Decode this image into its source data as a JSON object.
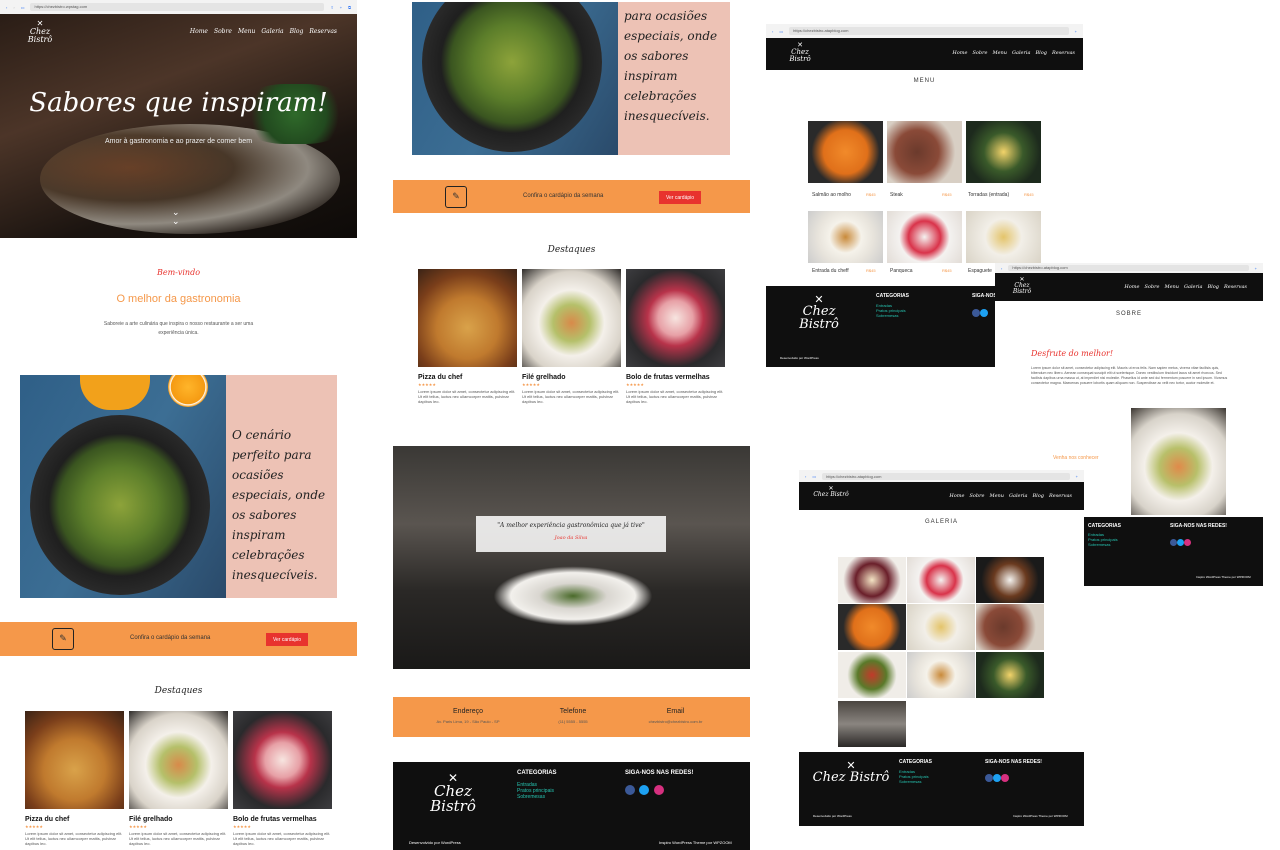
{
  "browser": {
    "url": "https://chezbistro.wpstag.com",
    "url_short": "https://chezbistro.atapblog.com"
  },
  "site": {
    "logo": "Chez Bistrô",
    "nav": [
      "Home",
      "Sobre",
      "Menu",
      "Galeria",
      "Blog",
      "Reservas"
    ]
  },
  "hero": {
    "title": "Sabores que inspiram!",
    "subtitle": "Amor à gastronomia e ao prazer de comer bem"
  },
  "welcome": {
    "kicker": "Bem-vindo",
    "title": "O melhor da gastronomia",
    "text": "Saboreie a arte culinária que inspira o nosso restaurante a ser uma experiência única."
  },
  "feature": {
    "quote": "O cenário perfeito para ocasiões especiais, onde os sabores inspiram celebrações inesquecíveis.",
    "quote_partial": "para ocasiões especiais, onde os sabores inspiram celebrações inesquecíveis."
  },
  "cta": {
    "text": "Confira o cardápio da semana",
    "button": "Ver cardápio"
  },
  "highlights": {
    "title": "Destaques",
    "items": [
      {
        "name": "Pizza du chef",
        "stars": "★★★★★",
        "text": "Lorem ipsum dolor sit amet, consectetur adipiscing elit. Ut elit tellus, luctus nec ullamcorper mattis, pulvinar dapibus leo."
      },
      {
        "name": "Filé grelhado",
        "stars": "★★★★★",
        "text": "Lorem ipsum dolor sit amet, consectetur adipiscing elit. Ut elit tellus, luctus nec ullamcorper mattis, pulvinar dapibus leo."
      },
      {
        "name": "Bolo de frutas vermelhas",
        "stars": "★★★★★",
        "text": "Lorem ipsum dolor sit amet, consectetur adipiscing elit. Ut elit tellus, luctus nec ullamcorper mattis, pulvinar dapibus leo."
      }
    ]
  },
  "testimonial": {
    "quote": "\"A melhor experiência gastronômica que já tive\"",
    "author": "Joao da Silva"
  },
  "contact": {
    "address_label": "Endereço",
    "address": "Av. Paris Lima, 19 - São Paulo - SP",
    "phone_label": "Telefone",
    "phone": "(11) 5555 - 5555",
    "email_label": "Email",
    "email": "chezbistro@chezbistro.com.br"
  },
  "footer": {
    "categories_title": "CATEGORIAS",
    "categories": [
      "Entradas",
      "Pratos principais",
      "Sobremesas"
    ],
    "social_title": "SIGA-NOS NAS REDES!",
    "dev": "Desenvolvido por WordPress",
    "theme": "Inspiro WordPress Theme por WPZOOM"
  },
  "menu_page": {
    "title": "MENU",
    "items": [
      {
        "name": "Salmão ao molho",
        "price": "R$45"
      },
      {
        "name": "Steak",
        "price": "R$45"
      },
      {
        "name": "Torradas (entrada)",
        "price": "R$45"
      },
      {
        "name": "Entrada du cheff",
        "price": "R$45"
      },
      {
        "name": "Panqueca",
        "price": "R$45"
      },
      {
        "name": "Espaguete",
        "price": ""
      }
    ]
  },
  "about_page": {
    "title": "SOBRE",
    "kicker": "Desfrute do melhor!",
    "text": "Lorem ipsum dolor sit amet, consectetur adipiscing elit. Mauris ut eros felis. Nam sapien metus, viverra vitae facilisis quis, bibendum nec libero. Aenean consequat suscipit elit ut scelerisque. Donec vestibulum tincidunt lacus sit amet rhoncus. Sed facilisis dapibus urna massa ut, at imperdiet nisi molestie. Phasellus id ante sed dui fermentum posuere in sed ipsum. Vivamus consectetur magna. Maecenas posuere lobortis quam aliquam non. Suspendisse ac velit nec tortor, auctor molestie et.",
    "link": "Venha nos conhecer"
  },
  "gallery_page": {
    "title": "GALERIA"
  },
  "colors": {
    "orange": "#f5984a",
    "pink": "#edc2b5",
    "red": "#e8332e",
    "teal": "#26c3b0",
    "dark": "#0f0f0f"
  }
}
